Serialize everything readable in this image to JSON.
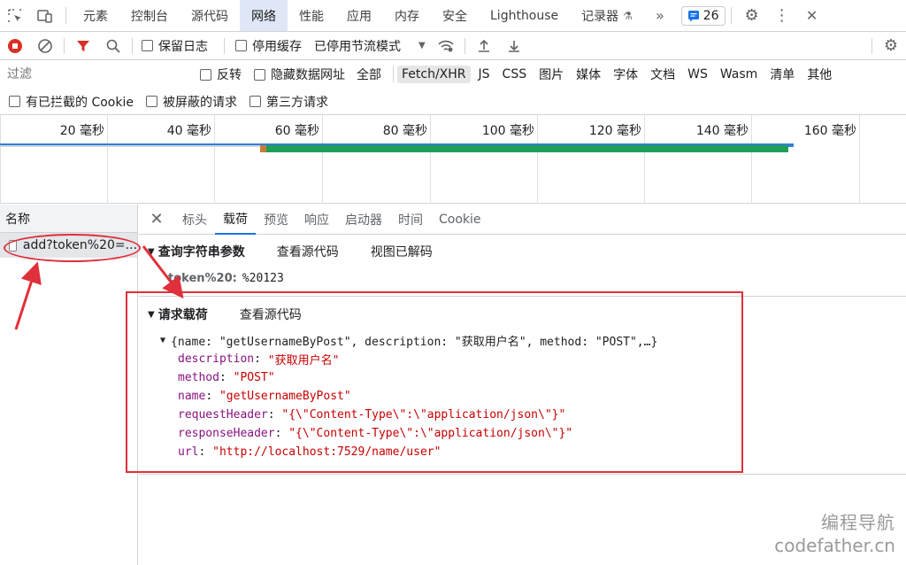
{
  "tabs": [
    "元素",
    "控制台",
    "源代码",
    "网络",
    "性能",
    "应用",
    "内存",
    "安全",
    "Lighthouse",
    "记录器"
  ],
  "active_tab": "网络",
  "issues_count": "26",
  "toolbar": {
    "preserve_log": "保留日志",
    "disable_cache": "停用缓存",
    "throttle": "已停用节流模式"
  },
  "filter": {
    "placeholder": "过滤",
    "invert": "反转",
    "hide_data_urls": "隐藏数据网址",
    "types": [
      "全部",
      "Fetch/XHR",
      "JS",
      "CSS",
      "图片",
      "媒体",
      "字体",
      "文档",
      "WS",
      "Wasm",
      "清单",
      "其他"
    ],
    "active_type": "Fetch/XHR"
  },
  "cookie_row": {
    "blocked_cookies": "有已拦截的 Cookie",
    "blocked_requests": "被屏蔽的请求",
    "third_party": "第三方请求"
  },
  "timeline": {
    "ticks": [
      "20 毫秒",
      "40 毫秒",
      "60 毫秒",
      "80 毫秒",
      "100 毫秒",
      "120 毫秒",
      "140 毫秒",
      "160 毫秒"
    ]
  },
  "request_list": {
    "header": "名称",
    "items": [
      {
        "name": "add?token%20=..."
      }
    ]
  },
  "detail": {
    "tabs": [
      "标头",
      "载荷",
      "预览",
      "响应",
      "启动器",
      "时间",
      "Cookie"
    ],
    "active_tab": "载荷",
    "query": {
      "title": "查询字符串参数",
      "view_source": "查看源代码",
      "view_decoded": "视图已解码",
      "param_key": "token%20",
      "param_value": "%20123"
    },
    "payload": {
      "title": "请求载荷",
      "view_source": "查看源代码",
      "summary": "{name: \"getUsernameByPost\", description: \"获取用户名\", method: \"POST\",…}",
      "fields": [
        {
          "key": "description",
          "value": "\"获取用户名\""
        },
        {
          "key": "method",
          "value": "\"POST\""
        },
        {
          "key": "name",
          "value": "\"getUsernameByPost\""
        },
        {
          "key": "requestHeader",
          "value": "\"{\\\"Content-Type\\\":\\\"application/json\\\"}\""
        },
        {
          "key": "responseHeader",
          "value": "\"{\\\"Content-Type\\\":\\\"application/json\\\"}\""
        },
        {
          "key": "url",
          "value": "\"http://localhost:7529/name/user\""
        }
      ]
    }
  },
  "watermark": {
    "line1": "编程导航",
    "line2": "codefather.cn"
  },
  "colors": {
    "annotation_red": "#e0303b",
    "active_tab_bg": "#dfe6f5",
    "key_purple": "#881280",
    "string_red": "#c80000"
  }
}
